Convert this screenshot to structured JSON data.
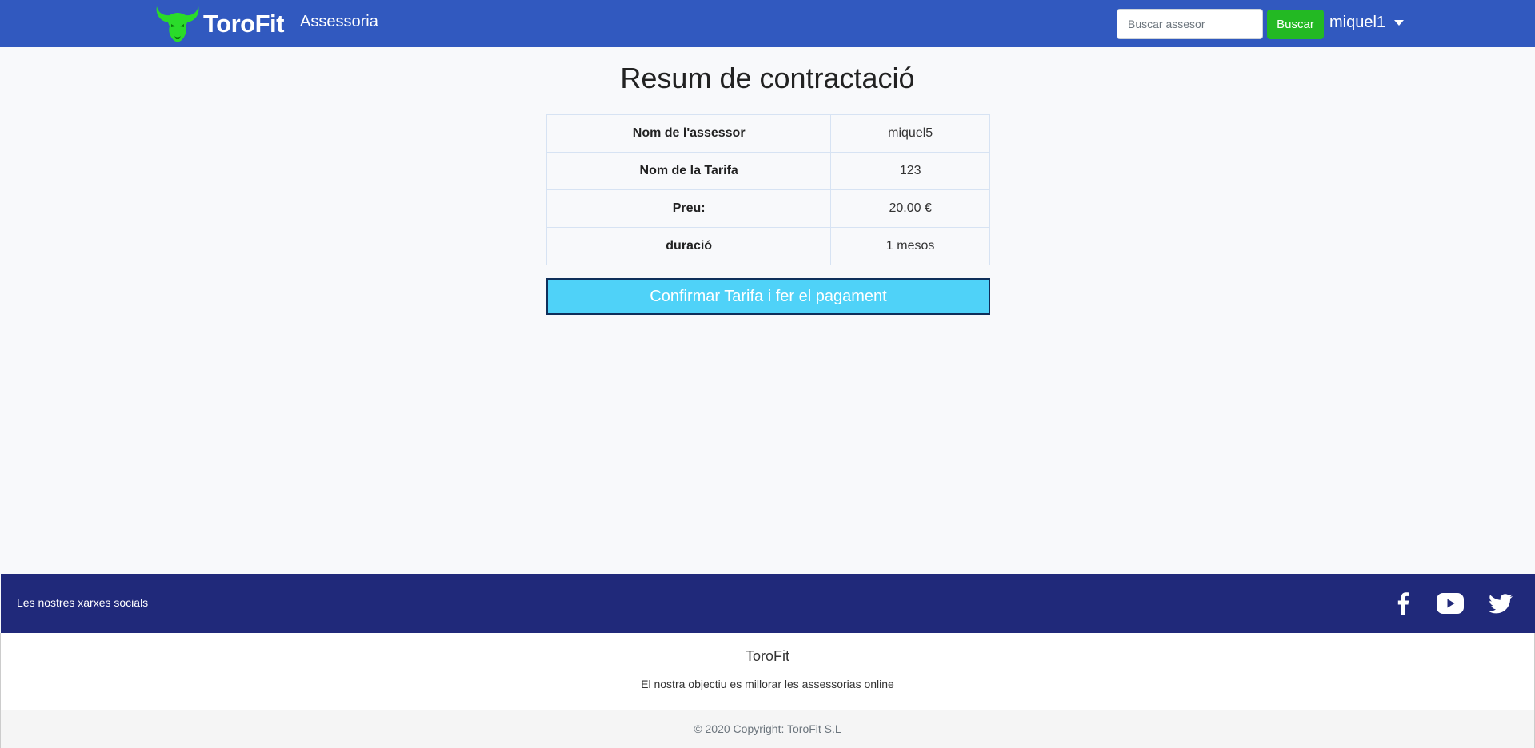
{
  "navbar": {
    "brand": "ToroFit",
    "nav_link": "Assessoria",
    "search_placeholder": "Buscar assesor",
    "search_button": "Buscar",
    "user": "miquel1",
    "logo_icon": "bull-icon",
    "colors": {
      "background": "#3159bf",
      "search_button": "#23b923",
      "logo": "#2adb2a"
    }
  },
  "main": {
    "title": "Resum de contractació",
    "rows": [
      {
        "label": "Nom de l'assessor",
        "value": "miquel5"
      },
      {
        "label": "Nom de la Tarifa",
        "value": "123"
      },
      {
        "label": "Preu:",
        "value": "20.00 €"
      },
      {
        "label": "duració",
        "value": "1 mesos"
      }
    ],
    "confirm_button": "Confirmar Tarifa i fer el pagament",
    "colors": {
      "confirm_button": "#4fd2f8"
    }
  },
  "footer": {
    "social_text": "Les nostres xarxes socials",
    "social_icons": [
      "facebook-icon",
      "youtube-icon",
      "twitter-icon"
    ],
    "brand": "ToroFit",
    "tagline": "El nostra objectiu es millorar les assessorias online",
    "copyright": "© 2020 Copyright: ToroFit S.L",
    "colors": {
      "social_bar": "#20297a",
      "copyright_bar": "#f5f5f5"
    }
  }
}
